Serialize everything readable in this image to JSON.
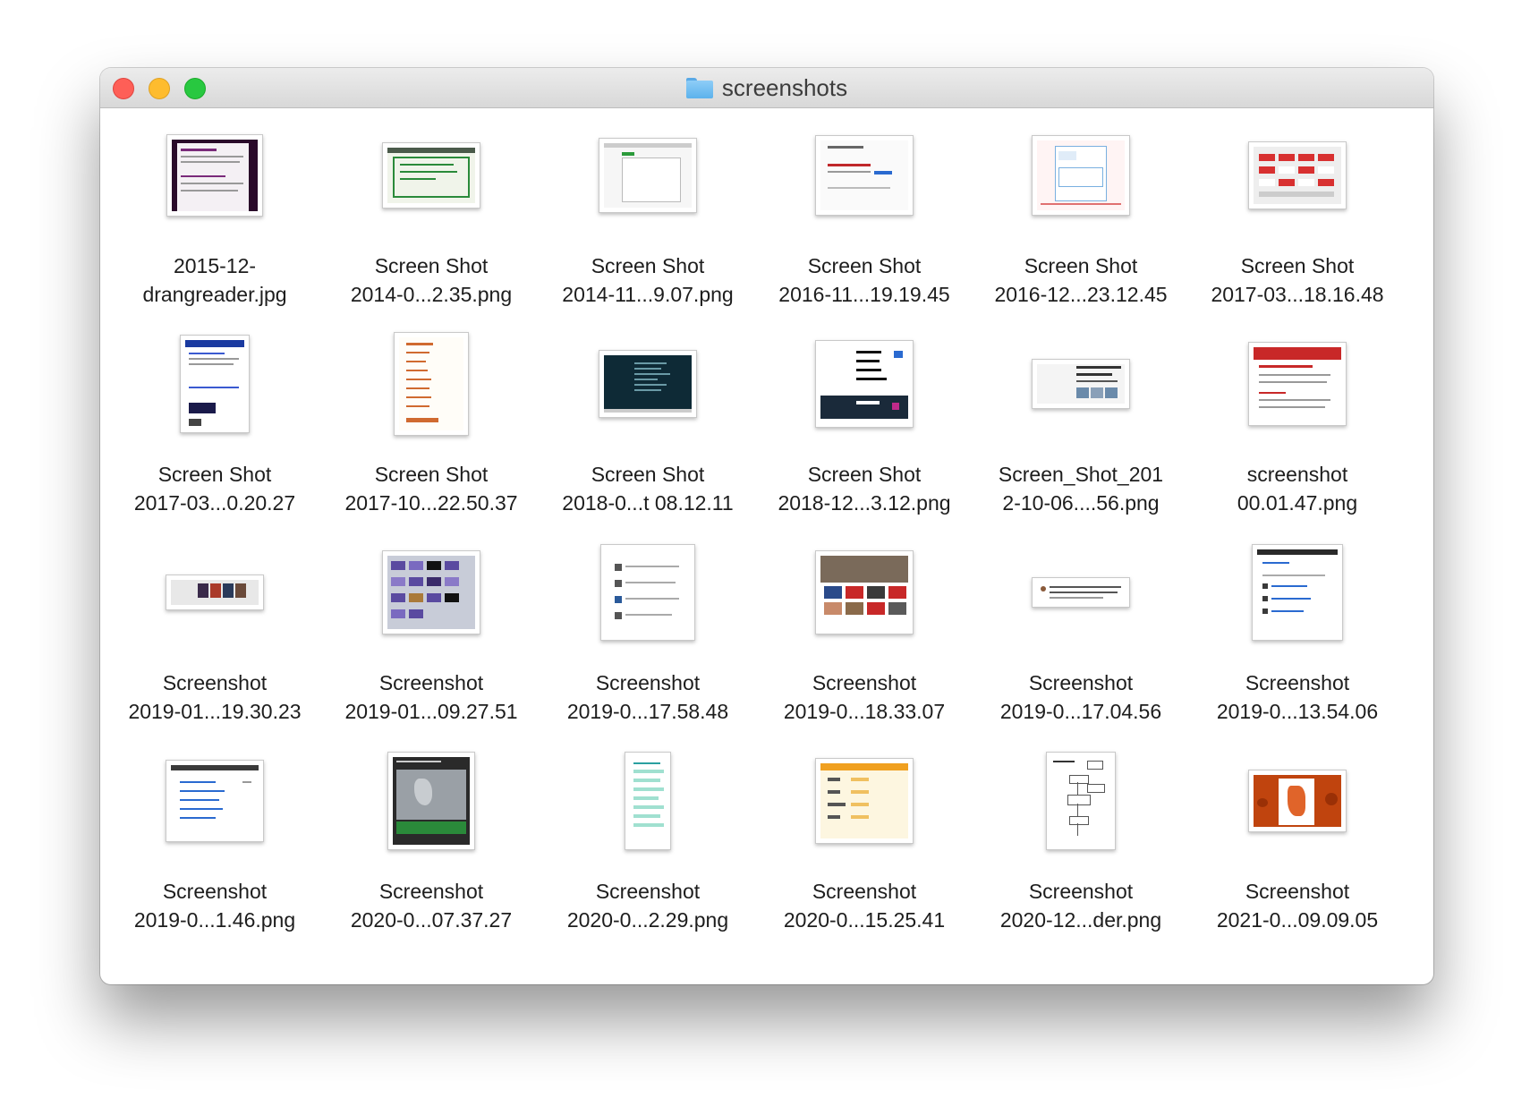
{
  "window": {
    "title": "screenshots",
    "folder_icon": "folder-icon"
  },
  "files": [
    {
      "name_line1": "2015-12-",
      "name_line2": "drangreader.jpg"
    },
    {
      "name_line1": "Screen Shot",
      "name_line2": "2014-0...2.35.png"
    },
    {
      "name_line1": "Screen Shot",
      "name_line2": "2014-11...9.07.png"
    },
    {
      "name_line1": "Screen Shot",
      "name_line2": "2016-11...19.19.45"
    },
    {
      "name_line1": "Screen Shot",
      "name_line2": "2016-12...23.12.45"
    },
    {
      "name_line1": "Screen Shot",
      "name_line2": "2017-03...18.16.48"
    },
    {
      "name_line1": "Screen Shot",
      "name_line2": "2017-03...0.20.27"
    },
    {
      "name_line1": "Screen Shot",
      "name_line2": "2017-10...22.50.37"
    },
    {
      "name_line1": "Screen Shot",
      "name_line2": "2018-0...t 08.12.11"
    },
    {
      "name_line1": "Screen Shot",
      "name_line2": "2018-12...3.12.png"
    },
    {
      "name_line1": "Screen_Shot_201",
      "name_line2": "2-10-06....56.png"
    },
    {
      "name_line1": "screenshot",
      "name_line2": "00.01.47.png"
    },
    {
      "name_line1": "Screenshot",
      "name_line2": "2019-01...19.30.23"
    },
    {
      "name_line1": "Screenshot",
      "name_line2": "2019-01...09.27.51"
    },
    {
      "name_line1": "Screenshot",
      "name_line2": "2019-0...17.58.48"
    },
    {
      "name_line1": "Screenshot",
      "name_line2": "2019-0...18.33.07"
    },
    {
      "name_line1": "Screenshot",
      "name_line2": "2019-0...17.04.56"
    },
    {
      "name_line1": "Screenshot",
      "name_line2": "2019-0...13.54.06"
    },
    {
      "name_line1": "Screenshot",
      "name_line2": "2019-0...1.46.png"
    },
    {
      "name_line1": "Screenshot",
      "name_line2": "2020-0...07.37.27"
    },
    {
      "name_line1": "Screenshot",
      "name_line2": "2020-0...2.29.png"
    },
    {
      "name_line1": "Screenshot",
      "name_line2": "2020-0...15.25.41"
    },
    {
      "name_line1": "Screenshot",
      "name_line2": "2020-12...der.png"
    },
    {
      "name_line1": "Screenshot",
      "name_line2": "2021-0...09.09.05"
    }
  ],
  "colors": {
    "close": "#fe5f57",
    "minimize": "#febc2e",
    "zoom": "#28c840",
    "folder": "#5cb2ec"
  }
}
